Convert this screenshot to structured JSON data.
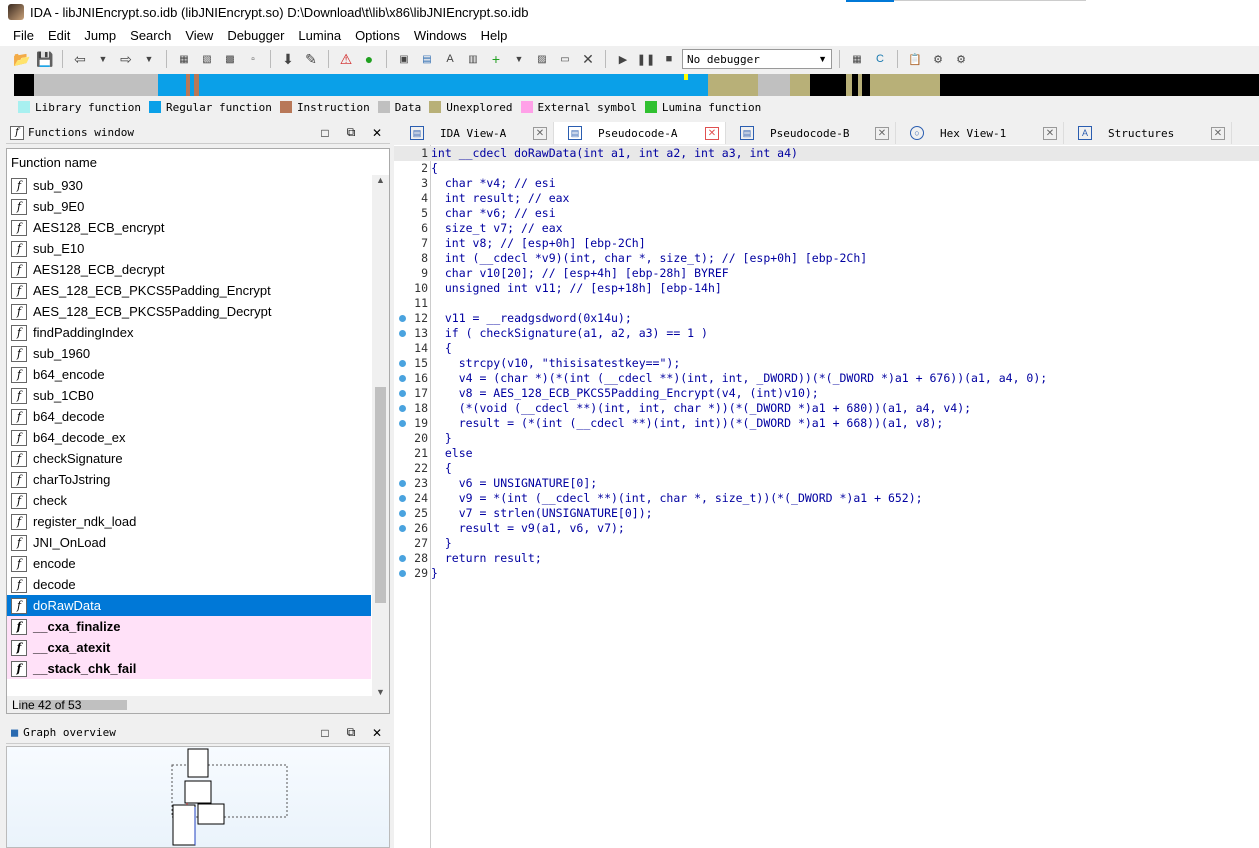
{
  "window": {
    "title": "IDA - libJNIEncrypt.so.idb (libJNIEncrypt.so) D:\\Download\\t\\lib\\x86\\libJNIEncrypt.so.idb"
  },
  "menu": [
    "File",
    "Edit",
    "Jump",
    "Search",
    "View",
    "Debugger",
    "Lumina",
    "Options",
    "Windows",
    "Help"
  ],
  "toolbar": {
    "debugger_select": "No debugger"
  },
  "legend": [
    {
      "label": "Library function",
      "color": "#a8f0f0"
    },
    {
      "label": "Regular function",
      "color": "#0aa0e8"
    },
    {
      "label": "Instruction",
      "color": "#b87858"
    },
    {
      "label": "Data",
      "color": "#c0c0c0"
    },
    {
      "label": "Unexplored",
      "color": "#b8b078"
    },
    {
      "label": "External symbol",
      "color": "#ffa0e8"
    },
    {
      "label": "Lumina function",
      "color": "#30c030"
    }
  ],
  "functions_window": {
    "title": "Functions window",
    "column": "Function name",
    "items": [
      "sub_930",
      "sub_9E0",
      "AES128_ECB_encrypt",
      "sub_E10",
      "AES128_ECB_decrypt",
      "AES_128_ECB_PKCS5Padding_Encrypt",
      "AES_128_ECB_PKCS5Padding_Decrypt",
      "findPaddingIndex",
      "sub_1960",
      "b64_encode",
      "sub_1CB0",
      "b64_decode",
      "b64_decode_ex",
      "checkSignature",
      "charToJstring",
      "check",
      "register_ndk_load",
      "JNI_OnLoad",
      "encode",
      "decode",
      "doRawData",
      "__cxa_finalize",
      "__cxa_atexit",
      "__stack_chk_fail"
    ],
    "selected": "doRawData",
    "external": [
      "__cxa_finalize",
      "__cxa_atexit",
      "__stack_chk_fail"
    ],
    "status": "Line 42 of 53"
  },
  "graph_overview": {
    "title": "Graph overview"
  },
  "tabs": [
    {
      "label": "IDA View-A",
      "icon": "ida-view-icon",
      "active": false
    },
    {
      "label": "Pseudocode-A",
      "icon": "pseudocode-icon",
      "active": true
    },
    {
      "label": "Pseudocode-B",
      "icon": "pseudocode-icon",
      "active": false
    },
    {
      "label": "Hex View-1",
      "icon": "hex-view-icon",
      "active": false
    },
    {
      "label": "Structures",
      "icon": "structures-icon",
      "active": false
    }
  ],
  "code": [
    {
      "n": "1",
      "t": "int __cdecl doRawData(int a1, int a2, int a3, int a4)",
      "dot": false
    },
    {
      "n": "2",
      "t": "{",
      "dot": false
    },
    {
      "n": "3",
      "t": "  char *v4; // esi",
      "dot": false
    },
    {
      "n": "4",
      "t": "  int result; // eax",
      "dot": false
    },
    {
      "n": "5",
      "t": "  char *v6; // esi",
      "dot": false
    },
    {
      "n": "6",
      "t": "  size_t v7; // eax",
      "dot": false
    },
    {
      "n": "7",
      "t": "  int v8; // [esp+0h] [ebp-2Ch]",
      "dot": false
    },
    {
      "n": "8",
      "t": "  int (__cdecl *v9)(int, char *, size_t); // [esp+0h] [ebp-2Ch]",
      "dot": false
    },
    {
      "n": "9",
      "t": "  char v10[20]; // [esp+4h] [ebp-28h] BYREF",
      "dot": false
    },
    {
      "n": "10",
      "t": "  unsigned int v11; // [esp+18h] [ebp-14h]",
      "dot": false
    },
    {
      "n": "11",
      "t": "",
      "dot": false
    },
    {
      "n": "12",
      "t": "  v11 = __readgsdword(0x14u);",
      "dot": true
    },
    {
      "n": "13",
      "t": "  if ( checkSignature(a1, a2, a3) == 1 )",
      "dot": true
    },
    {
      "n": "14",
      "t": "  {",
      "dot": false
    },
    {
      "n": "15",
      "t": "    strcpy(v10, \"thisisatestkey==\");",
      "dot": true
    },
    {
      "n": "16",
      "t": "    v4 = (char *)(*(int (__cdecl **)(int, int, _DWORD))(*(_DWORD *)a1 + 676))(a1, a4, 0);",
      "dot": true
    },
    {
      "n": "17",
      "t": "    v8 = AES_128_ECB_PKCS5Padding_Encrypt(v4, (int)v10);",
      "dot": true
    },
    {
      "n": "18",
      "t": "    (*(void (__cdecl **)(int, int, char *))(*(_DWORD *)a1 + 680))(a1, a4, v4);",
      "dot": true
    },
    {
      "n": "19",
      "t": "    result = (*(int (__cdecl **)(int, int))(*(_DWORD *)a1 + 668))(a1, v8);",
      "dot": true
    },
    {
      "n": "20",
      "t": "  }",
      "dot": false
    },
    {
      "n": "21",
      "t": "  else",
      "dot": false
    },
    {
      "n": "22",
      "t": "  {",
      "dot": false
    },
    {
      "n": "23",
      "t": "    v6 = UNSIGNATURE[0];",
      "dot": true
    },
    {
      "n": "24",
      "t": "    v9 = *(int (__cdecl **)(int, char *, size_t))(*(_DWORD *)a1 + 652);",
      "dot": true
    },
    {
      "n": "25",
      "t": "    v7 = strlen(UNSIGNATURE[0]);",
      "dot": true
    },
    {
      "n": "26",
      "t": "    result = v9(a1, v6, v7);",
      "dot": true
    },
    {
      "n": "27",
      "t": "  }",
      "dot": false
    },
    {
      "n": "28",
      "t": "  return result;",
      "dot": true
    },
    {
      "n": "29",
      "t": "}",
      "dot": true
    }
  ]
}
